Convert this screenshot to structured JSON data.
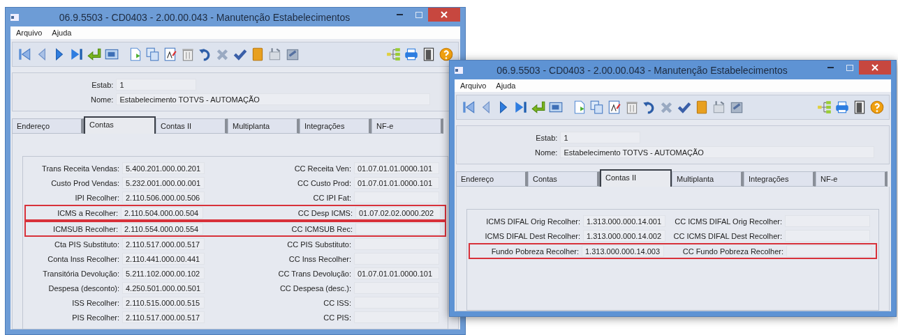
{
  "windows": [
    {
      "title": "06.9.5503 - CD0403 - 2.00.00.043 - Manutenção Estabelecimentos",
      "active": false,
      "menu": [
        "Arquivo",
        "Ajuda"
      ],
      "estab_label": "Estab:",
      "estab": "1",
      "nome_label": "Nome:",
      "nome": "Estabelecimento TOTVS - AUTOMAÇÃO",
      "tabs": [
        {
          "label": "Endereço",
          "selected": false
        },
        {
          "label": "Contas",
          "selected": true
        },
        {
          "label": "Contas II",
          "selected": false
        },
        {
          "label": "Multiplanta",
          "selected": false
        },
        {
          "label": "Integrações",
          "selected": false
        },
        {
          "label": "NF-e",
          "selected": false
        }
      ],
      "rows": [
        {
          "label": "Trans Receita Vendas:",
          "value": "5.400.201.000.00.201",
          "cc_label": "CC Receita Ven:",
          "cc_value": "01.07.01.01.0000.101",
          "highlighted": false
        },
        {
          "label": "Custo Prod Vendas:",
          "value": "5.232.001.000.00.001",
          "cc_label": "CC Custo Prod:",
          "cc_value": "01.07.01.01.0000.101",
          "highlighted": false
        },
        {
          "label": "IPI Recolher:",
          "value": "2.110.506.000.00.506",
          "cc_label": "CC IPI Fat:",
          "cc_value": "",
          "highlighted": false
        },
        {
          "label": "ICMS a Recolher:",
          "value": "2.110.504.000.00.504",
          "cc_label": "CC Desp ICMS:",
          "cc_value": "01.07.02.02.0000.202",
          "highlighted": true
        },
        {
          "label": "ICMSUB Recolher:",
          "value": "2.110.554.000.00.554",
          "cc_label": "CC ICMSUB Rec:",
          "cc_value": "",
          "highlighted": true
        },
        {
          "label": "Cta PIS Substituto:",
          "value": "2.110.517.000.00.517",
          "cc_label": "CC PIS Substituto:",
          "cc_value": "",
          "highlighted": false
        },
        {
          "label": "Conta Inss Recolher:",
          "value": "2.110.441.000.00.441",
          "cc_label": "CC Inss Recolher:",
          "cc_value": "",
          "highlighted": false
        },
        {
          "label": "Transitória Devolução:",
          "value": "5.211.102.000.00.102",
          "cc_label": "CC Trans Devolução:",
          "cc_value": "01.07.01.01.0000.101",
          "highlighted": false
        },
        {
          "label": "Despesa (desconto):",
          "value": "4.250.501.000.00.501",
          "cc_label": "CC Despesa (desc.):",
          "cc_value": "",
          "highlighted": false
        },
        {
          "label": "ISS Recolher:",
          "value": "2.110.515.000.00.515",
          "cc_label": "CC ISS:",
          "cc_value": "",
          "highlighted": false
        },
        {
          "label": "PIS Recolher:",
          "value": "2.110.517.000.00.517",
          "cc_label": "CC PIS:",
          "cc_value": "",
          "highlighted": false
        }
      ]
    },
    {
      "title": "06.9.5503 - CD0403 - 2.00.00.043 - Manutenção Estabelecimentos",
      "active": true,
      "menu": [
        "Arquivo",
        "Ajuda"
      ],
      "estab_label": "Estab:",
      "estab": "1",
      "nome_label": "Nome:",
      "nome": "Estabelecimento TOTVS - AUTOMAÇÃO",
      "tabs": [
        {
          "label": "Endereço",
          "selected": false
        },
        {
          "label": "Contas",
          "selected": false
        },
        {
          "label": "Contas II",
          "selected": true
        },
        {
          "label": "Multiplanta",
          "selected": false
        },
        {
          "label": "Integrações",
          "selected": false
        },
        {
          "label": "NF-e",
          "selected": false
        }
      ],
      "rows": [
        {
          "label": "ICMS DIFAL Orig Recolher:",
          "value": "1.313.000.000.14.001",
          "cc_label": "CC ICMS DIFAL Orig Recolher:",
          "cc_value": "",
          "highlighted": false
        },
        {
          "label": "ICMS DIFAL Dest Recolher:",
          "value": "1.313.000.000.14.002",
          "cc_label": "CC ICMS DIFAL Dest Recolher:",
          "cc_value": "",
          "highlighted": false
        },
        {
          "label": "Fundo Pobreza Recolher:",
          "value": "1.313.000.000.14.003",
          "cc_label": "CC Fundo Pobreza Recolher:",
          "cc_value": "",
          "highlighted": true
        }
      ]
    }
  ]
}
